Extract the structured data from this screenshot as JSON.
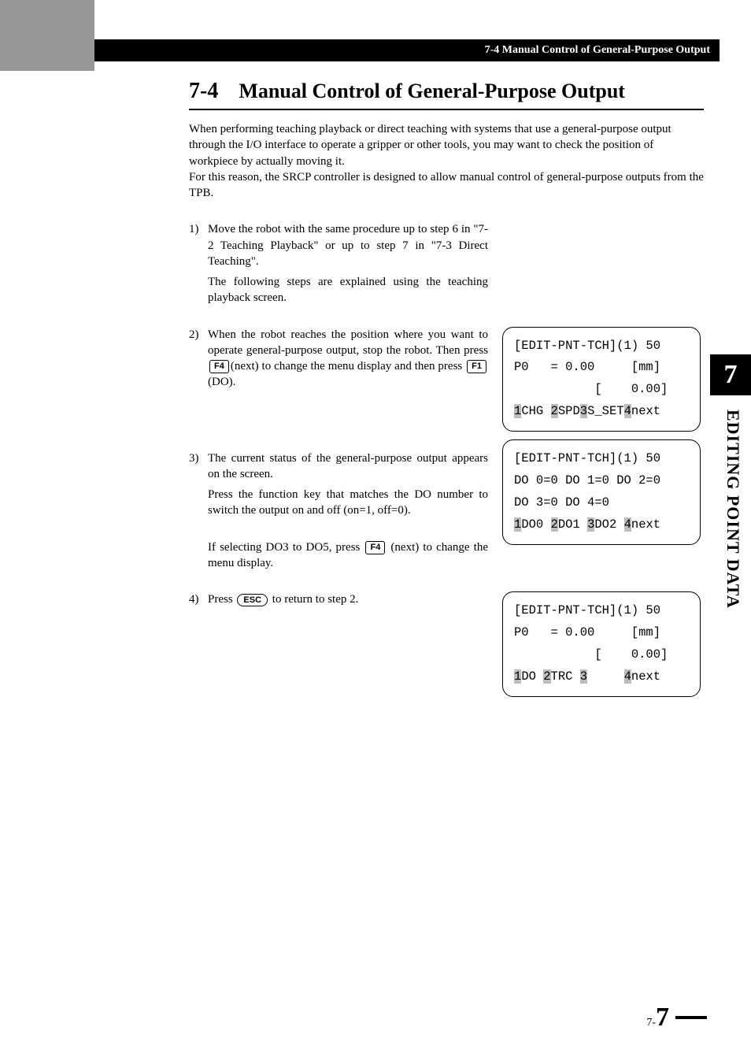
{
  "header": {
    "breadcrumb": "7-4 Manual Control of General-Purpose Output"
  },
  "section": {
    "number": "7-4",
    "title": "Manual Control of General-Purpose Output",
    "intro1": "When performing teaching playback or direct teaching with systems that use a general-purpose output through the I/O interface to operate a gripper or other tools, you may want to check the position of workpiece by actually moving it.",
    "intro2": "For this reason, the SRCP controller is designed to allow manual control of general-purpose outputs from the TPB."
  },
  "steps": [
    {
      "num": "1)",
      "p1": "Move the robot with the same procedure up to step 6 in \"7-2 Teaching Playback\" or up to step 7 in \"7-3 Direct Teaching\".",
      "p2": "The following steps are explained using the teaching playback screen."
    },
    {
      "num": "2)",
      "p1a": "When the robot reaches the position where you want to operate general-purpose output, stop the robot. Then press ",
      "key1": "F4",
      "p1b": "(next) to change the menu display and then press ",
      "key2": "F1",
      "p1c": "(DO)."
    },
    {
      "num": "3)",
      "p1": "The current status of the general-purpose output appears on the screen.",
      "p2": "Press the function key that matches the DO number to switch the output on and off (on=1, off=0).",
      "p3a": "If selecting DO3 to DO5, press ",
      "key1": "F4",
      "p3b": " (next) to change the menu display."
    },
    {
      "num": "4)",
      "p1a": "Press ",
      "key1": "ESC",
      "p1b": " to return to step 2."
    }
  ],
  "terminals": {
    "t1": {
      "l1": "[EDIT-PNT-TCH](1) 50",
      "l2": "P0   = 0.00     [mm]",
      "l3": "           [    0.00]",
      "menu": {
        "k1": "1",
        "m1": "CHG ",
        "k2": "2",
        "m2": "SPD",
        "k3": "3",
        "m3": "S_SET",
        "k4": "4",
        "m4": "next"
      }
    },
    "t2": {
      "l1": "[EDIT-PNT-TCH](1) 50",
      "l2": "DO 0=0 DO 1=0 DO 2=0",
      "l3": "DO 3=0 DO 4=0",
      "menu": {
        "k1": "1",
        "m1": "DO0 ",
        "k2": "2",
        "m2": "DO1 ",
        "k3": "3",
        "m3": "DO2 ",
        "k4": "4",
        "m4": "next"
      }
    },
    "t3": {
      "l1": "[EDIT-PNT-TCH](1) 50",
      "l2": "P0   = 0.00     [mm]",
      "l3": "           [    0.00]",
      "menu": {
        "k1": "1",
        "m1": "DO ",
        "k2": "2",
        "m2": "TRC ",
        "k3": "3",
        "m3": "     ",
        "k4": "4",
        "m4": "next"
      }
    }
  },
  "sidebar": {
    "chapter": "7",
    "label": "EDITING POINT DATA"
  },
  "footer": {
    "prefix": "7-",
    "page": "7"
  }
}
